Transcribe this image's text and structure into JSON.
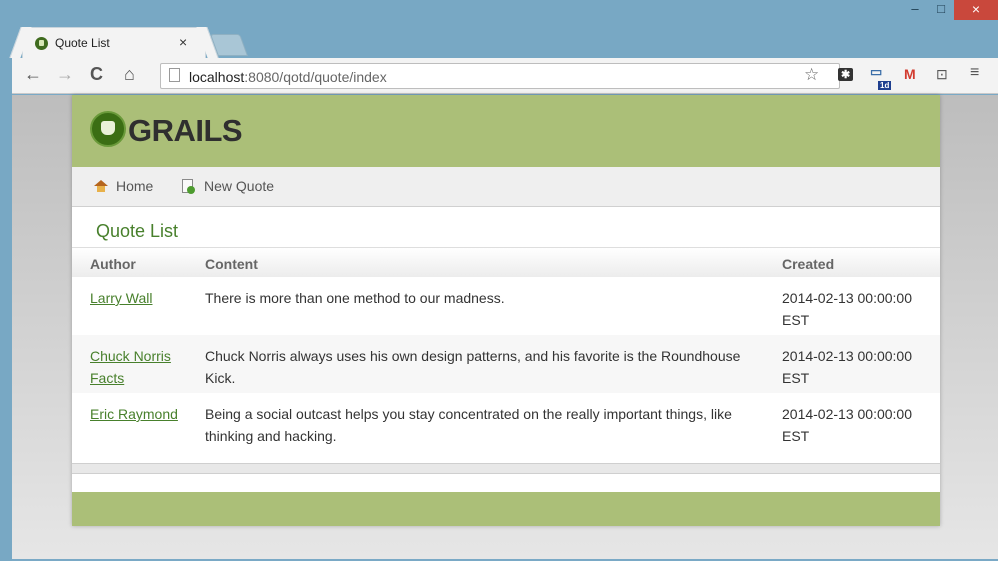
{
  "browser": {
    "tab_title": "Quote List",
    "tab_close": "×",
    "window_minimize": "–",
    "window_maximize": "□",
    "window_close": "×",
    "url_host": "localhost",
    "url_rest": ":8080/qotd/quote/index",
    "ext_badge": "1d"
  },
  "app": {
    "logo_text": "GRAILS",
    "nav": {
      "home_label": "Home",
      "new_label": "New Quote"
    },
    "page_title": "Quote List",
    "table": {
      "headers": [
        "Author",
        "Content",
        "Created"
      ],
      "rows": [
        {
          "author": "Larry Wall",
          "content": "There is more than one method to our madness.",
          "created": "2014-02-13 00:00:00 EST"
        },
        {
          "author": "Chuck Norris Facts",
          "content": "Chuck Norris always uses his own design patterns, and his favorite is the Roundhouse Kick.",
          "created": "2014-02-13 00:00:00 EST"
        },
        {
          "author": "Eric Raymond",
          "content": "Being a social outcast helps you stay concentrated on the really important things, like thinking and hacking.",
          "created": "2014-02-13 00:00:00 EST"
        }
      ]
    }
  },
  "colors": {
    "header_green": "#abbf78",
    "link_green": "#48802c",
    "titlebar_blue": "#78a8c4"
  }
}
